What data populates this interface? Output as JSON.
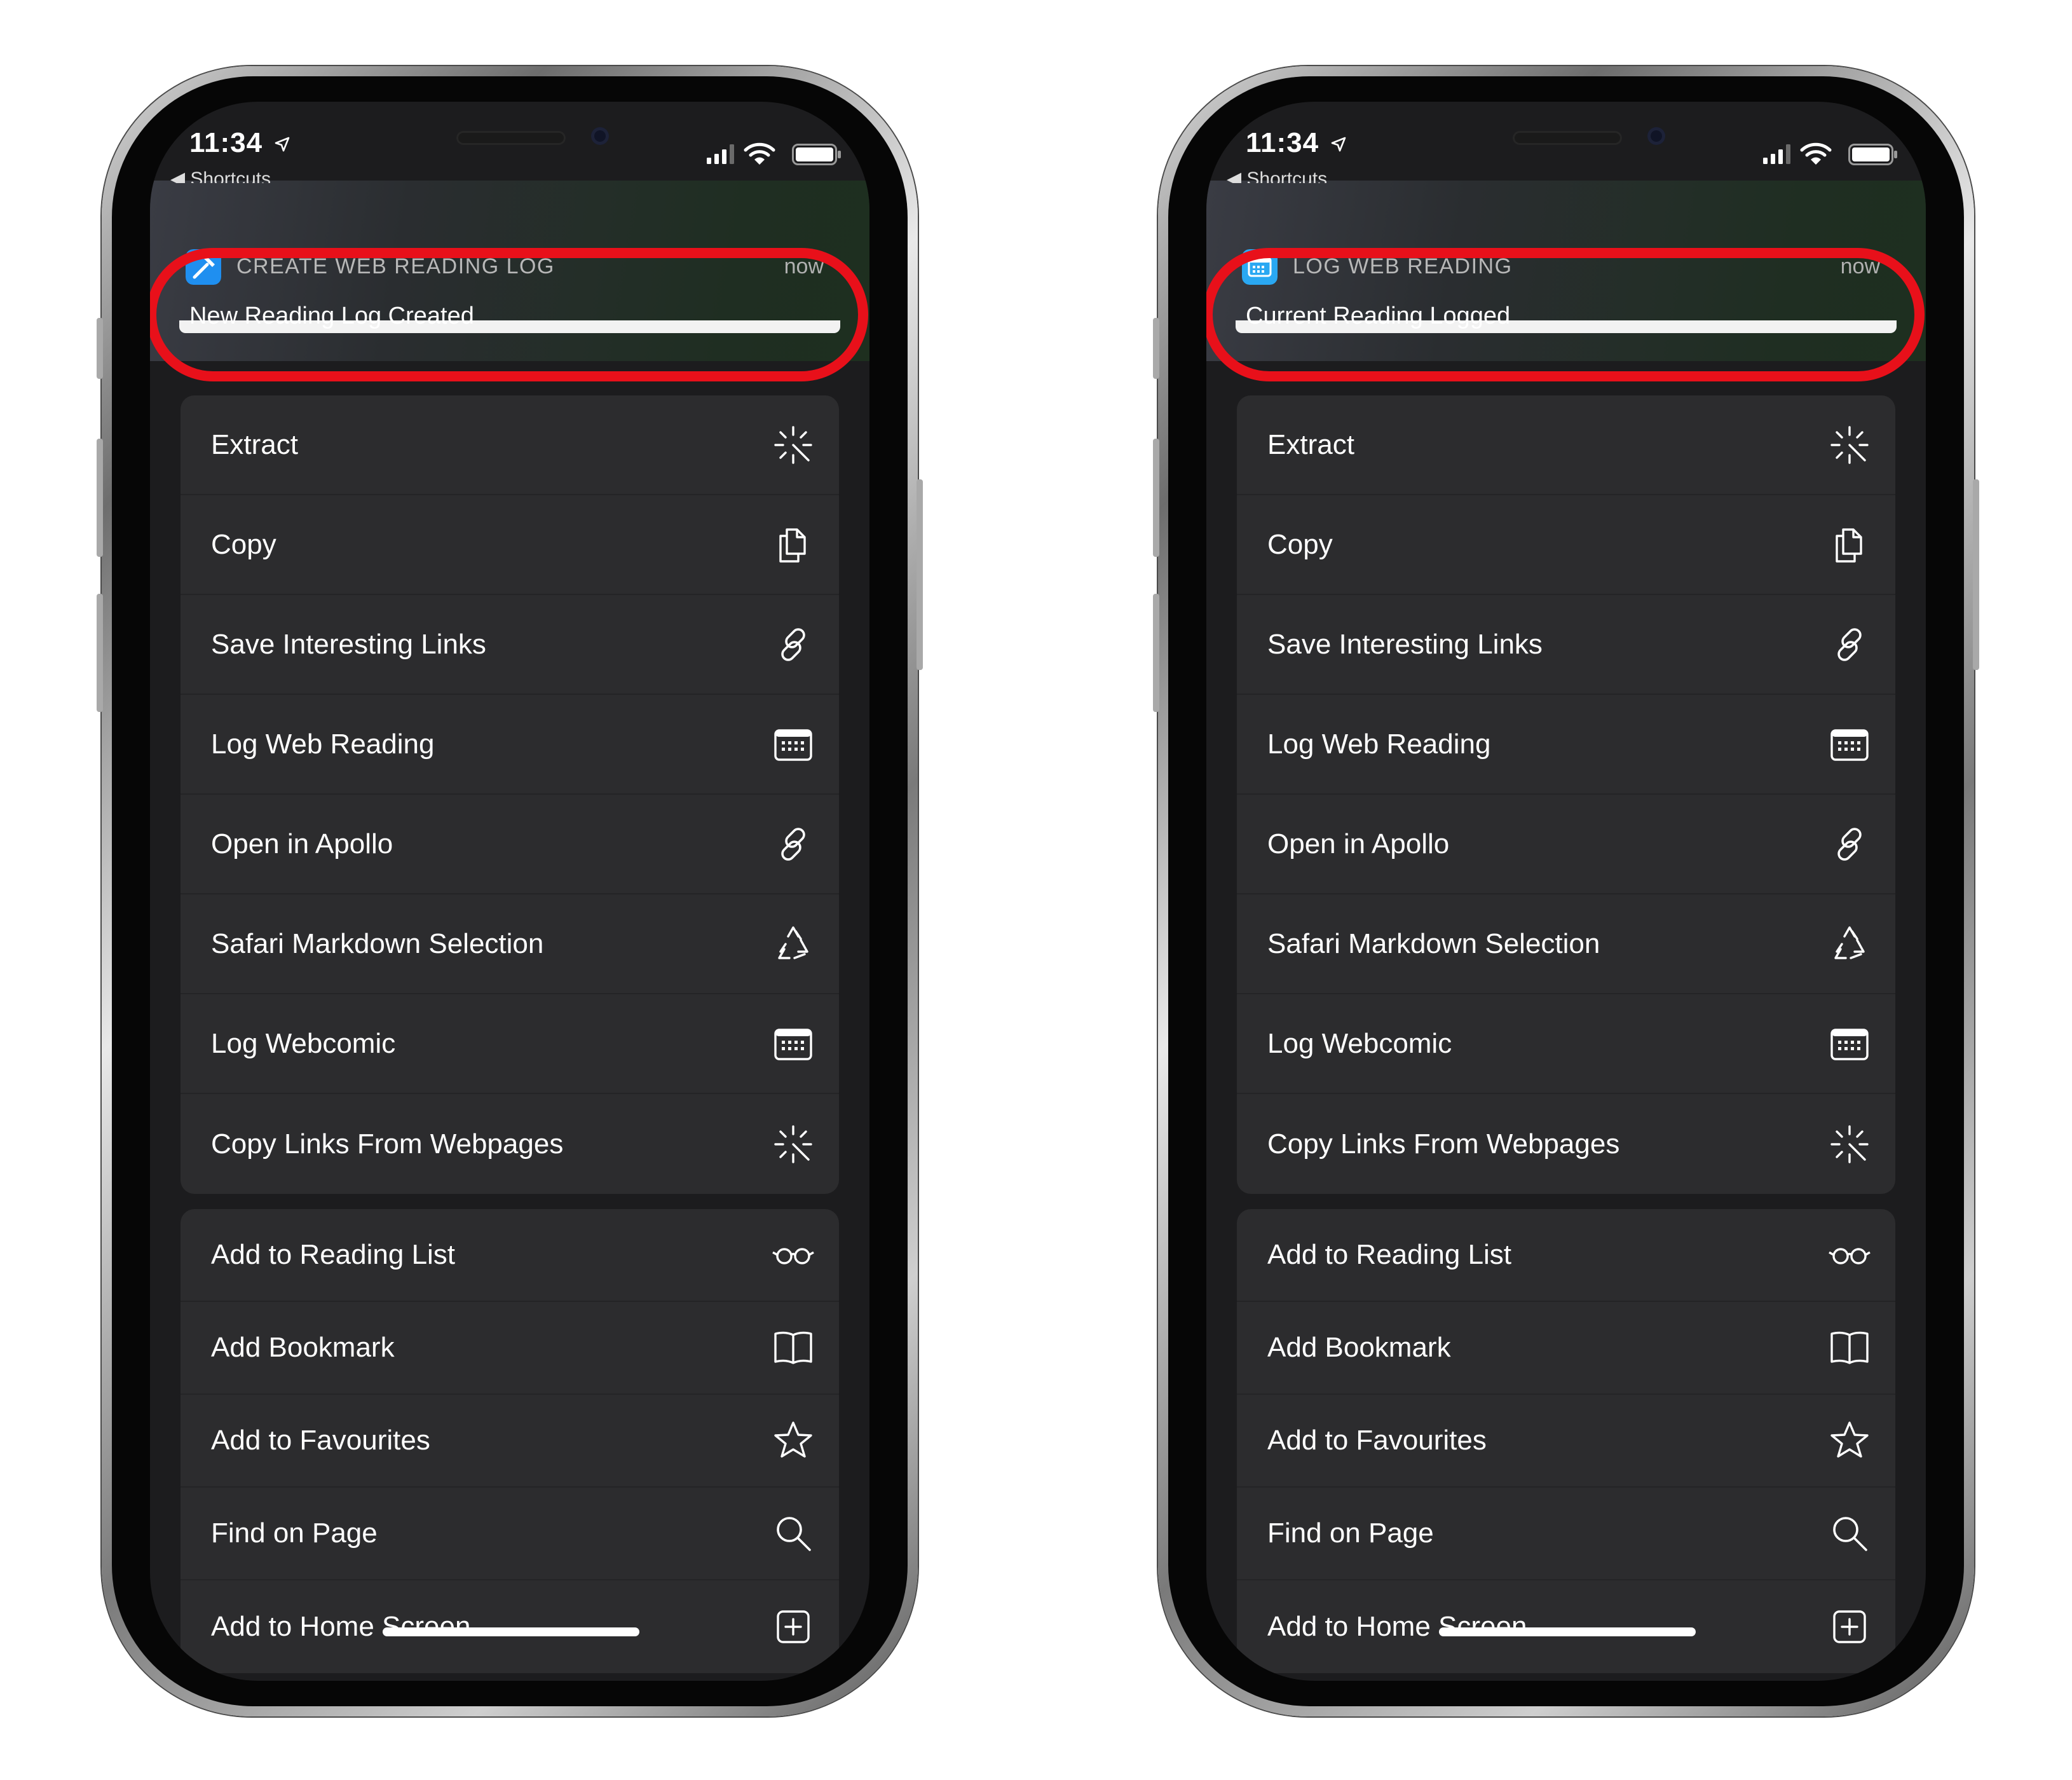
{
  "colors": {
    "highlight": "#e8101a",
    "menu_background": "#2c2c2e",
    "screen_background": "#1c1c1e",
    "left_app_icon": "#1f8ff0",
    "right_app_icon": "#2aa8f2"
  },
  "phones": [
    {
      "status": {
        "time": "11:34",
        "back_label": "Shortcuts"
      },
      "notification": {
        "app": "CREATE WEB READING LOG",
        "time": "now",
        "body": "New Reading Log Created",
        "icon": "hammer-icon"
      }
    },
    {
      "status": {
        "time": "11:34",
        "back_label": "Shortcuts"
      },
      "notification": {
        "app": "LOG WEB READING",
        "time": "now",
        "body": "Current Reading Logged",
        "icon": "calendar-icon"
      }
    }
  ],
  "menu": {
    "shortcuts": [
      {
        "label": "Extract",
        "icon": "magic-wand-icon"
      },
      {
        "label": "Copy",
        "icon": "copy-icon"
      },
      {
        "label": "Save Interesting Links",
        "icon": "link-icon"
      },
      {
        "label": "Log Web Reading",
        "icon": "calendar-icon"
      },
      {
        "label": "Open in Apollo",
        "icon": "link-icon"
      },
      {
        "label": "Safari Markdown Selection",
        "icon": "recycle-icon"
      },
      {
        "label": "Log Webcomic",
        "icon": "calendar-icon"
      },
      {
        "label": "Copy Links From Webpages",
        "icon": "magic-wand-icon"
      }
    ],
    "actions": [
      {
        "label": "Add to Reading List",
        "icon": "glasses-icon"
      },
      {
        "label": "Add Bookmark",
        "icon": "book-icon"
      },
      {
        "label": "Add to Favourites",
        "icon": "star-icon"
      },
      {
        "label": "Find on Page",
        "icon": "search-icon"
      },
      {
        "label": "Add to Home Screen",
        "icon": "plus-square-icon"
      }
    ]
  }
}
